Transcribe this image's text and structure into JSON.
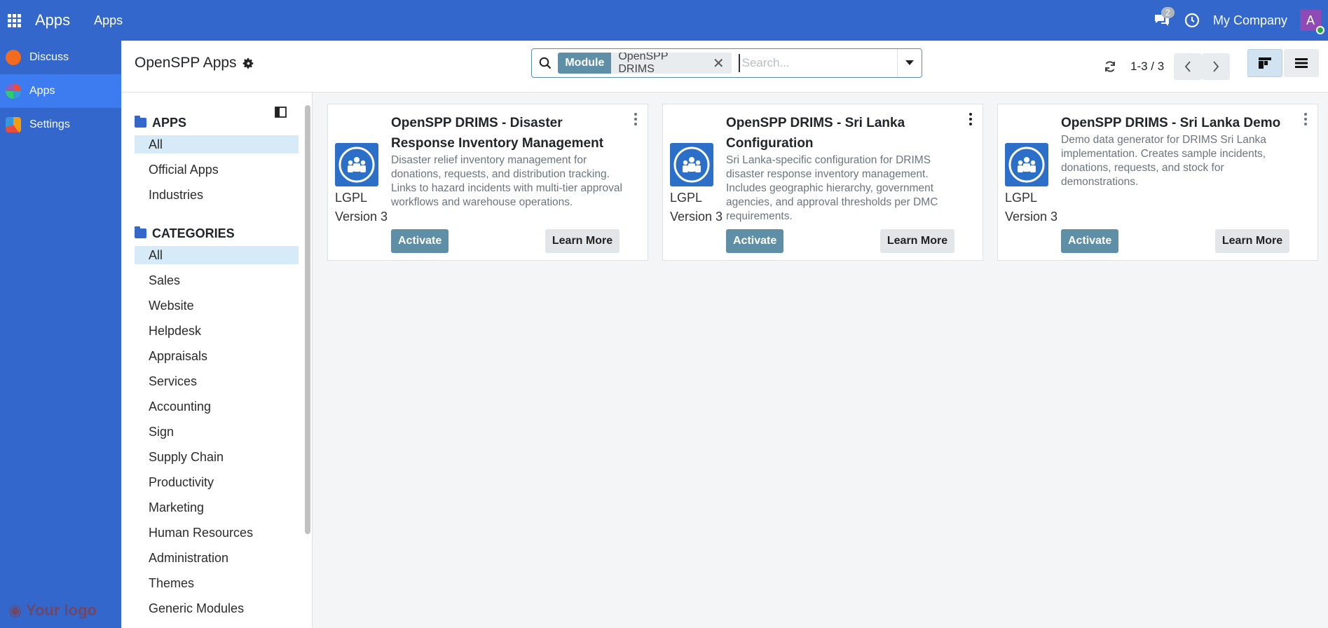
{
  "topbar": {
    "brand": "Apps",
    "menu_apps": "Apps",
    "messages_count": "2",
    "company": "My Company",
    "avatar_initial": "A"
  },
  "leftnav": {
    "items": [
      {
        "label": "Discuss"
      },
      {
        "label": "Apps"
      },
      {
        "label": "Settings"
      }
    ],
    "logo_text": "Your logo"
  },
  "control": {
    "title": "OpenSPP Apps",
    "facet_key": "Module",
    "facet_value": "OpenSPP DRIMS",
    "search_placeholder": "Search...",
    "pager": "1-3 / 3"
  },
  "sidepanel": {
    "apps_header": "APPS",
    "apps_items": [
      "All",
      "Official Apps",
      "Industries"
    ],
    "categories_header": "CATEGORIES",
    "categories_items": [
      "All",
      "Sales",
      "Website",
      "Helpdesk",
      "Appraisals",
      "Services",
      "Accounting",
      "Sign",
      "Supply Chain",
      "Productivity",
      "Marketing",
      "Human Resources",
      "Administration",
      "Themes",
      "Generic Modules"
    ]
  },
  "cards": [
    {
      "title": "OpenSPP DRIMS - Disaster Response Inventory Management",
      "description": "Disaster relief inventory management for donations, requests, and distribution tracking. Links to hazard incidents with multi-tier approval workflows and warehouse operations.",
      "license_line1": "LGPL",
      "license_line2": "Version 3",
      "activate": "Activate",
      "learn_more": "Learn More"
    },
    {
      "title": "OpenSPP DRIMS - Sri Lanka Configuration",
      "description": "Sri Lanka-specific configuration for DRIMS disaster response inventory management. Includes geographic hierarchy, government agencies, and approval thresholds per DMC requirements.",
      "license_line1": "LGPL",
      "license_line2": "Version 3",
      "activate": "Activate",
      "learn_more": "Learn More"
    },
    {
      "title": "OpenSPP DRIMS - Sri Lanka Demo",
      "description": "Demo data generator for DRIMS Sri Lanka implementation. Creates sample incidents, donations, requests, and stock for demonstrations.",
      "license_line1": "LGPL",
      "license_line2": "Version 3",
      "activate": "Activate",
      "learn_more": "Learn More"
    }
  ],
  "colors": {
    "primary": "#3367cc",
    "active_nav": "#3d7cf0",
    "activate_btn": "#5f8fa6",
    "selected_item": "#d6eaf8"
  }
}
